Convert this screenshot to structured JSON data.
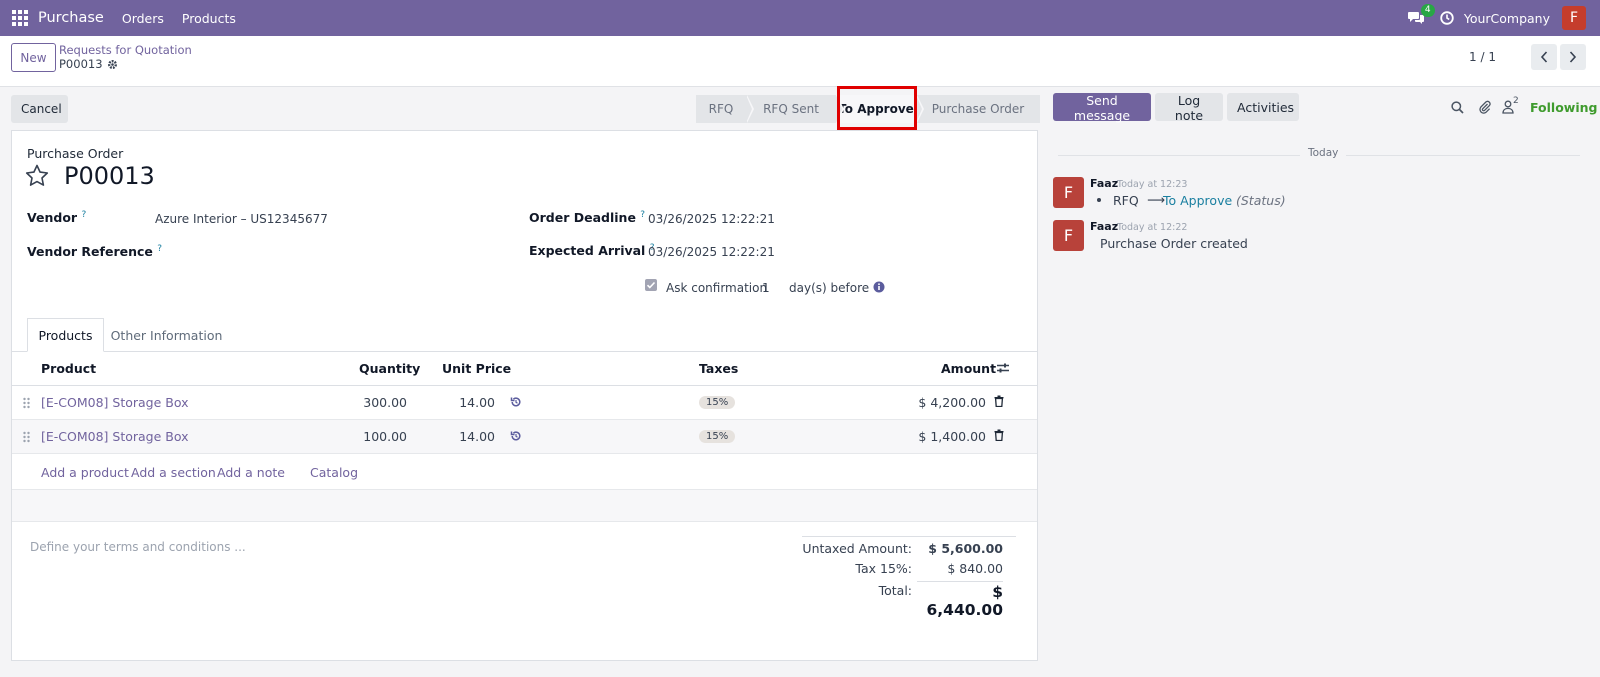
{
  "navbar": {
    "app_name": "Purchase",
    "menu_orders": "Orders",
    "menu_products": "Products",
    "messages_count": "4",
    "company": "YourCompany",
    "user_initial": "F"
  },
  "control_panel": {
    "new_label": "New",
    "breadcrumb_parent": "Requests for Quotation",
    "breadcrumb_current": "P00013",
    "pager": "1 / 1"
  },
  "actions": {
    "cancel_label": "Cancel",
    "stages": [
      {
        "label": "RFQ",
        "active": false
      },
      {
        "label": "RFQ Sent",
        "active": false
      },
      {
        "label": "To Approve",
        "active": true
      },
      {
        "label": "Purchase Order",
        "active": false
      }
    ]
  },
  "form": {
    "doc_type": "Purchase Order",
    "name": "P00013",
    "vendor_label": "Vendor",
    "vendor_value": "Azure Interior – US12345677",
    "vendor_ref_label": "Vendor Reference",
    "vendor_ref_value": "",
    "order_deadline_label": "Order Deadline",
    "order_deadline_value": "03/26/2025 12:22:21",
    "expected_arrival_label": "Expected Arrival",
    "expected_arrival_value": "03/26/2025 12:22:21",
    "ask_confirmation_label": "Ask confirmation",
    "ask_confirmation_days": "1",
    "days_before_label": "day(s) before",
    "help_mark": "?"
  },
  "tabs": [
    {
      "label": "Products",
      "active": true
    },
    {
      "label": "Other Information",
      "active": false
    }
  ],
  "table": {
    "headers": {
      "product": "Product",
      "quantity": "Quantity",
      "unit_price": "Unit Price",
      "taxes": "Taxes",
      "amount": "Amount"
    },
    "rows": [
      {
        "product": "[E-COM08] Storage Box",
        "quantity": "300.00",
        "unit_price": "14.00",
        "tax": "15%",
        "amount": "$ 4,200.00"
      },
      {
        "product": "[E-COM08] Storage Box",
        "quantity": "100.00",
        "unit_price": "14.00",
        "tax": "15%",
        "amount": "$ 1,400.00"
      }
    ],
    "add_product": "Add a product",
    "add_section": "Add a section",
    "add_note": "Add a note",
    "catalog": "Catalog"
  },
  "terms_placeholder": "Define your terms and conditions ...",
  "totals": {
    "untaxed_label": "Untaxed Amount:",
    "untaxed_value": "$ 5,600.00",
    "tax_label": "Tax 15%:",
    "tax_value": "$ 840.00",
    "total_label": "Total:",
    "total_value": "$ 6,440.00"
  },
  "chatter": {
    "send_message": "Send message",
    "log_note": "Log note",
    "activities": "Activities",
    "followers_count": "2",
    "following": "Following",
    "date_separator": "Today",
    "messages": [
      {
        "author": "Faaz",
        "initial": "F",
        "time": "Today at 12:23",
        "from": "RFQ",
        "to": "To Approve",
        "field": "(Status)"
      },
      {
        "author": "Faaz",
        "initial": "F",
        "time": "Today at 12:22",
        "body": "Purchase Order created"
      }
    ]
  },
  "colors": {
    "brand": "#71639e",
    "highlight": "#e00000",
    "link_blue": "#1a7fa0",
    "following_green": "#3f9b2e"
  }
}
